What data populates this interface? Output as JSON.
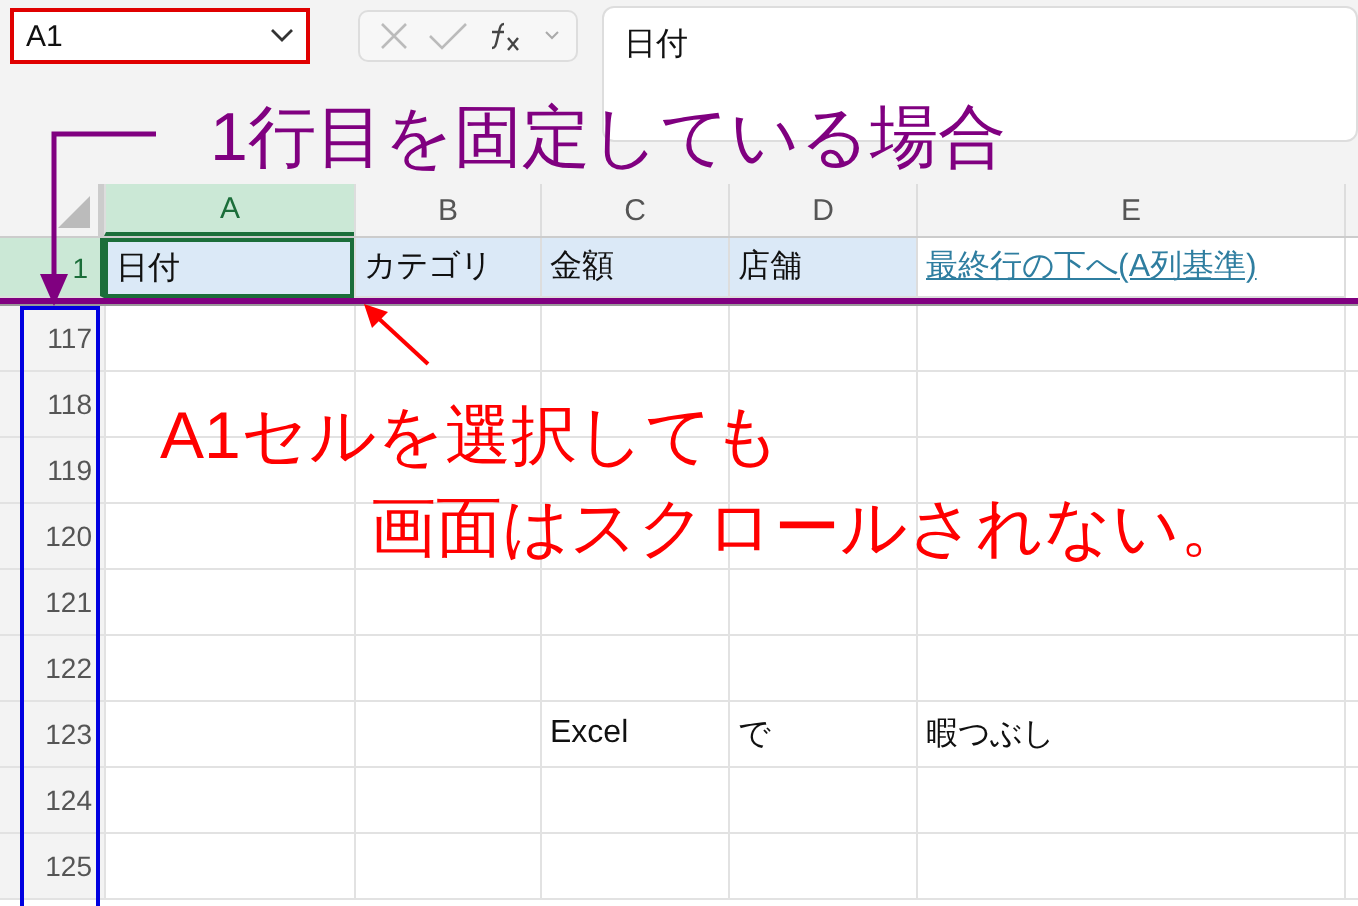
{
  "name_box": {
    "value": "A1"
  },
  "formula_bar": {
    "value": "日付"
  },
  "columns": [
    {
      "label": "A",
      "selected": true
    },
    {
      "label": "B",
      "selected": false
    },
    {
      "label": "C",
      "selected": false
    },
    {
      "label": "D",
      "selected": false
    },
    {
      "label": "E",
      "selected": false
    }
  ],
  "frozen_row": {
    "number": "1",
    "selected": true,
    "cells": [
      {
        "kind": "text",
        "text": "日付",
        "selected": true
      },
      {
        "kind": "text",
        "text": "カテゴリ",
        "selected": false
      },
      {
        "kind": "text",
        "text": "金額",
        "selected": false
      },
      {
        "kind": "text",
        "text": "店舗",
        "selected": false
      },
      {
        "kind": "link",
        "text": "最終行の下へ(A列基準)",
        "selected": false
      }
    ]
  },
  "rows": [
    {
      "number": "117"
    },
    {
      "number": "118"
    },
    {
      "number": "119"
    },
    {
      "number": "120"
    },
    {
      "number": "121"
    },
    {
      "number": "122"
    },
    {
      "number": "123",
      "cells": {
        "C": "Excel",
        "D": "で",
        "E": "暇つぶし"
      }
    },
    {
      "number": "124"
    },
    {
      "number": "125"
    }
  ],
  "freeze_note": {
    "text": "1行目を固定している場合"
  },
  "scroll_note": {
    "lines": [
      "A1セルを選択しても",
      "画面はスクロールされない。"
    ]
  }
}
